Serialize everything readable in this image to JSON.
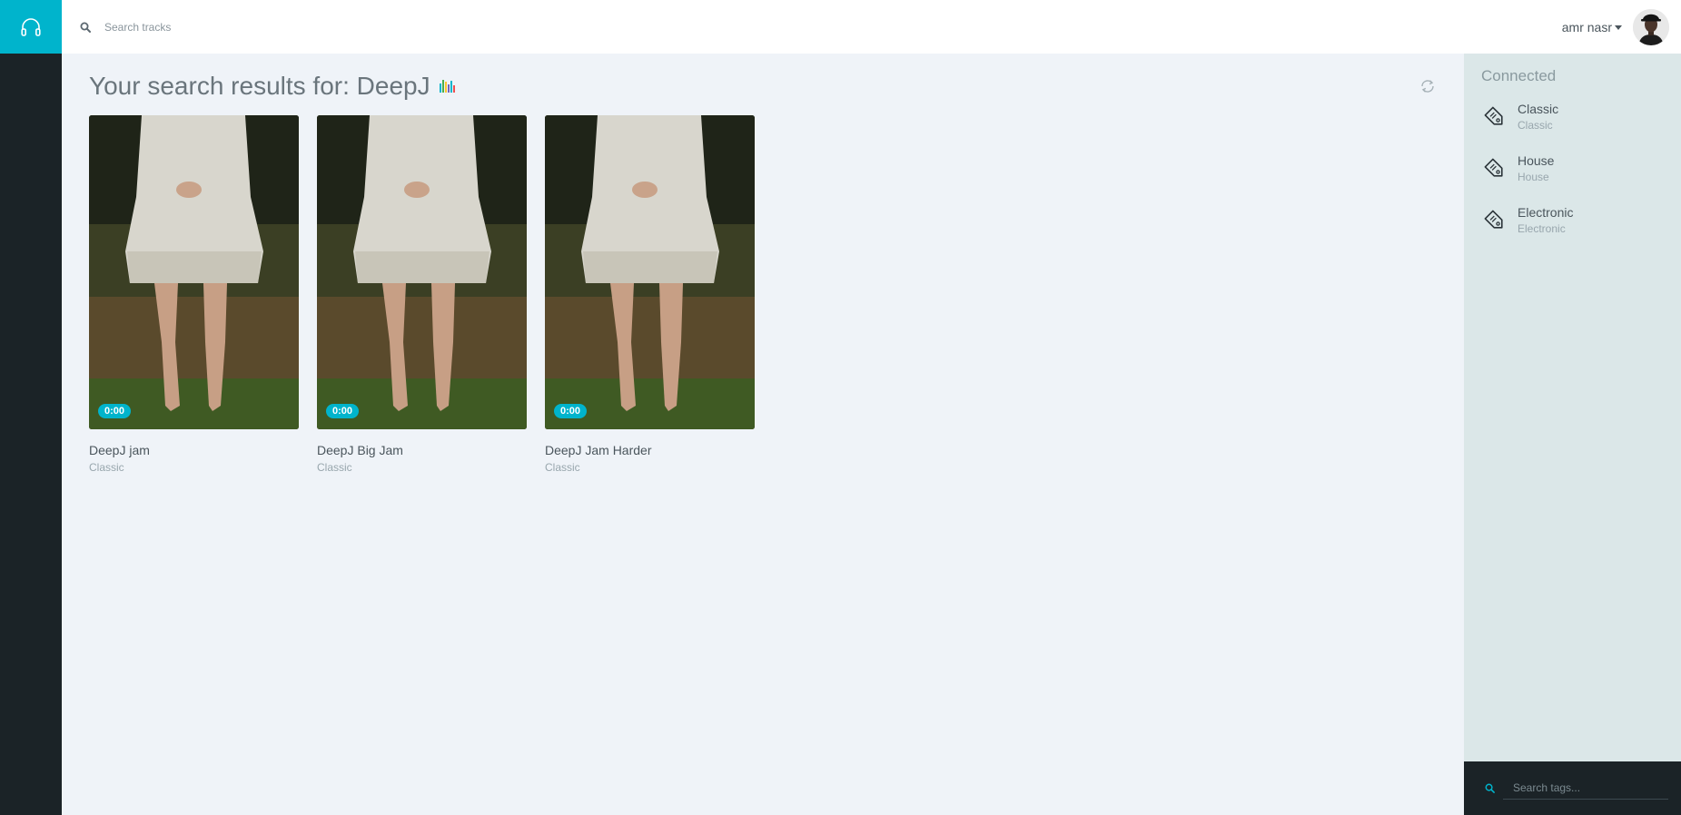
{
  "brand": {
    "icon": "headphones-icon",
    "color": "#00b4cc"
  },
  "header": {
    "search": {
      "icon": "search-icon",
      "placeholder": "Search tracks",
      "value": ""
    },
    "user": {
      "name": "amr nasr",
      "avatar": "user-avatar"
    }
  },
  "main": {
    "title": "Your search results for: DeepJ",
    "title_icon": "equalizer-icon",
    "refresh_icon": "refresh-icon",
    "tracks": [
      {
        "title": "DeepJ jam",
        "genre": "Classic",
        "duration": "0:00"
      },
      {
        "title": "DeepJ Big Jam",
        "genre": "Classic",
        "duration": "0:00"
      },
      {
        "title": "DeepJ Jam Harder",
        "genre": "Classic",
        "duration": "0:00"
      }
    ]
  },
  "aside": {
    "title": "Connected",
    "tags": [
      {
        "name": "Classic",
        "sub": "Classic",
        "icon": "tag-icon"
      },
      {
        "name": "House",
        "sub": "House",
        "icon": "tag-icon"
      },
      {
        "name": "Electronic",
        "sub": "Electronic",
        "icon": "tag-icon"
      }
    ],
    "search": {
      "icon": "search-icon",
      "placeholder": "Search tags...",
      "value": ""
    }
  },
  "colors": {
    "accent": "#00b4cc",
    "rail": "#1b2327",
    "aside": "#dbe7e8",
    "background": "#eff3f8"
  }
}
